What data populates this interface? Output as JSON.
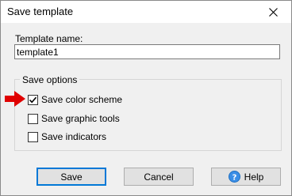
{
  "window": {
    "title": "Save template"
  },
  "template_name": {
    "label": "Template name:",
    "value": "template1"
  },
  "options": {
    "group_label": "Save options",
    "items": [
      {
        "label": "Save color scheme",
        "checked": true
      },
      {
        "label": "Save graphic tools",
        "checked": false
      },
      {
        "label": "Save indicators",
        "checked": false
      }
    ]
  },
  "buttons": {
    "save": "Save",
    "cancel": "Cancel",
    "help": "Help"
  },
  "colors": {
    "arrow": "#e00000",
    "accent": "#0078d7"
  },
  "icons": {
    "close": "close-icon",
    "help": "help-icon",
    "arrow": "red-arrow-icon"
  }
}
